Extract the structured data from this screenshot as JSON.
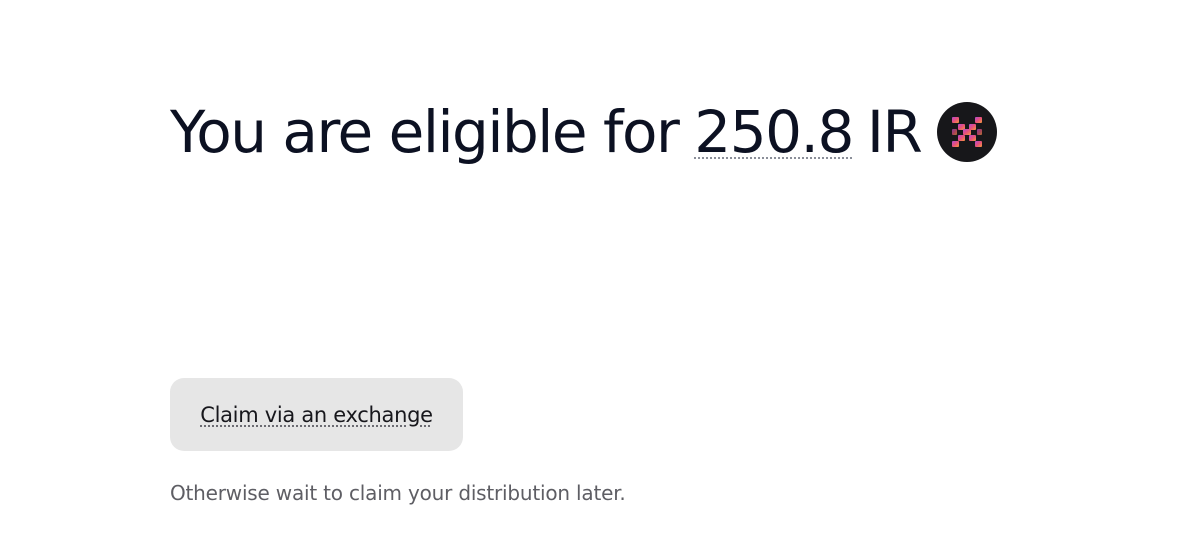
{
  "headline": {
    "prefix": "You are eligible for",
    "amount": "250.8",
    "symbol": "IR",
    "token_icon": "token-logo-icon"
  },
  "claim": {
    "button_label": "Claim via an exchange",
    "note": "Otherwise wait to claim your distribution later."
  },
  "colors": {
    "text_primary": "#0c1122",
    "button_bg": "#e6e6e6",
    "note_text": "#5e5e64",
    "token_icon_bg": "#17171a"
  }
}
